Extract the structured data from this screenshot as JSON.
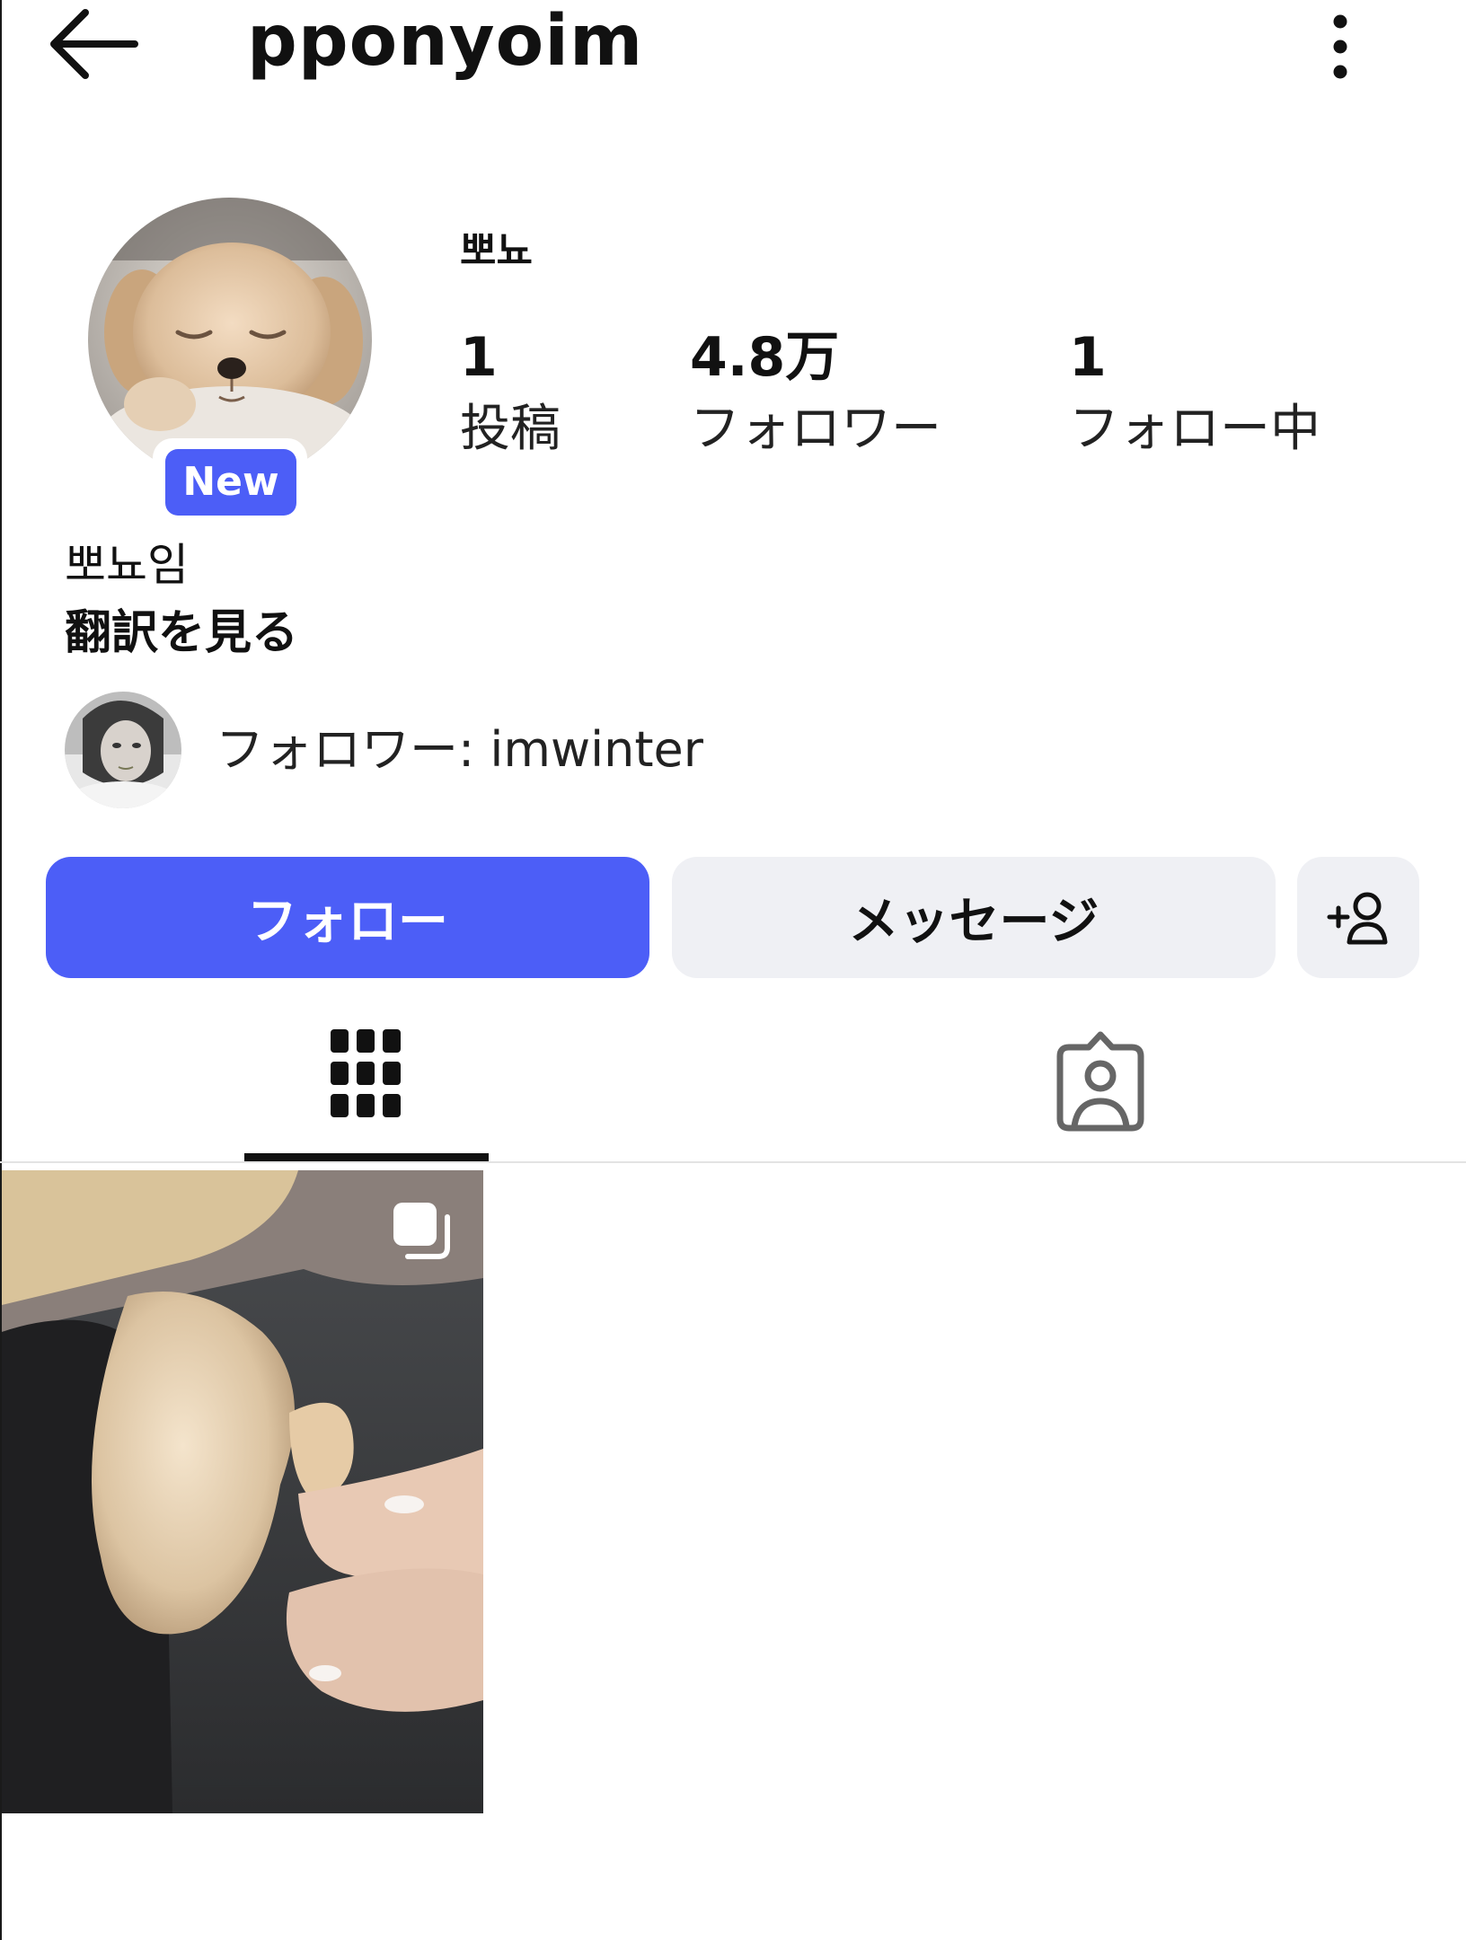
{
  "header": {
    "username": "pponyoim",
    "back_icon": "arrow-left-icon",
    "more_icon": "vertical-dots-icon"
  },
  "profile": {
    "display_name": "뽀뇨",
    "badge": "New",
    "stats": [
      {
        "value": "1",
        "label": "投稿"
      },
      {
        "value": "4.8万",
        "label": "フォロワー"
      },
      {
        "value": "1",
        "label": "フォロー中"
      }
    ],
    "bio": "뽀뇨임",
    "translate_label": "翻訳を見る",
    "mutual_followers": "フォロワー: imwinter"
  },
  "actions": {
    "follow_label": "フォロー",
    "message_label": "メッセージ",
    "add_user_icon": "add-person-icon"
  },
  "tabs": {
    "grid_icon": "grid-icon",
    "tagged_icon": "tagged-person-icon",
    "active": "grid"
  },
  "colors": {
    "accent": "#4c5ef7",
    "secondary_button": "#eff0f4"
  },
  "posts": [
    {
      "type": "carousel",
      "icon": "multiple-photos-icon"
    }
  ]
}
